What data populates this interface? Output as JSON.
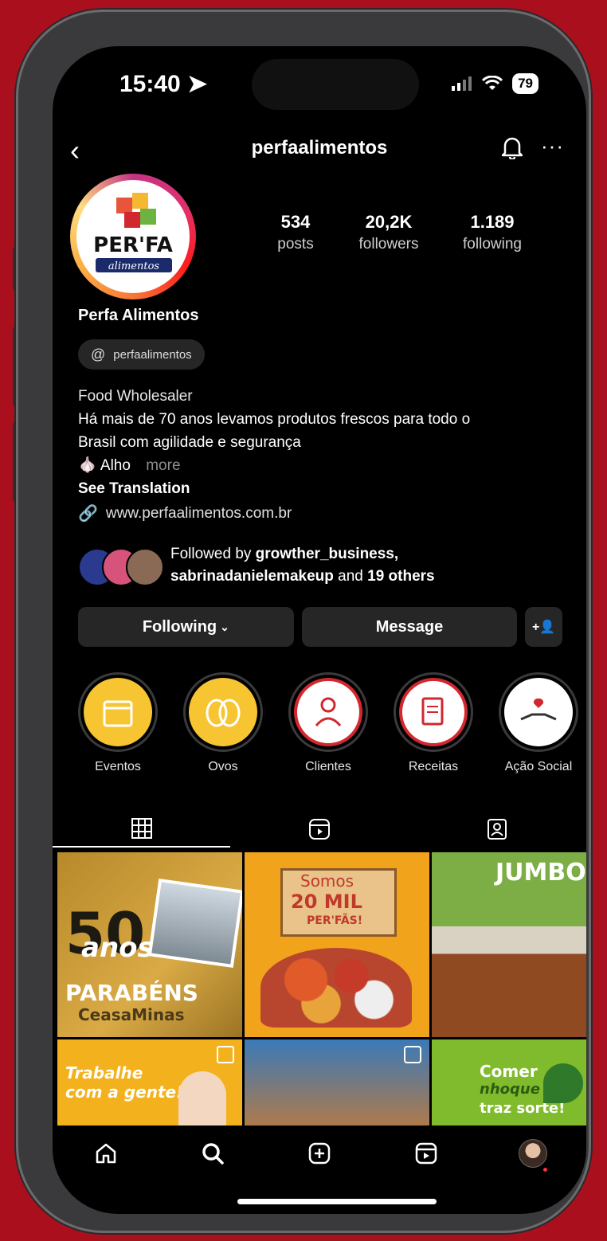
{
  "status_bar": {
    "time": "15:40",
    "battery": "79"
  },
  "header": {
    "username": "perfaalimentos"
  },
  "profile": {
    "avatar_brand": "PER'FA",
    "avatar_sub": "alimentos",
    "stats": [
      {
        "value": "534",
        "label": "posts"
      },
      {
        "value": "20,2K",
        "label": "followers"
      },
      {
        "value": "1.189",
        "label": "following"
      }
    ],
    "display_name": "Perfa Alimentos",
    "threads_handle": "perfaalimentos",
    "category": "Food Wholesaler",
    "bio_line1": "Há mais de 70 anos levamos produtos frescos para todo o",
    "bio_line2": "Brasil com agilidade e segurança",
    "bio_line3": "Alho",
    "bio_more": "more",
    "see_translation": "See Translation",
    "website": "www.perfaalimentos.com.br"
  },
  "followed_by": {
    "prefix": "Followed by",
    "user1": "growther_business,",
    "user2": "sabrinadanielemakeup",
    "and": "and",
    "others": "19 others"
  },
  "actions": {
    "following": "Following",
    "message": "Message"
  },
  "highlights": [
    {
      "label": "Eventos"
    },
    {
      "label": "Ovos"
    },
    {
      "label": "Clientes"
    },
    {
      "label": "Receitas"
    },
    {
      "label": "Ação Social"
    }
  ],
  "posts": {
    "p1_big": "50",
    "p1_script": "anos",
    "p1_caption": "PARABÉNS",
    "p1_sub": "CeasaMinas",
    "p2_line1": "Somos",
    "p2_line2": "20 MIL",
    "p2_line3": "PER'FÃS!",
    "p3_title": "JUMBO",
    "p4_line1": "Trabalhe",
    "p4_line2": "com a gente!",
    "p6_line1": "Comer",
    "p6_line2": "nhoque",
    "p6_line3": "traz sorte!"
  },
  "colors": {
    "background": "#a90f1c",
    "screen": "#000000",
    "button": "#262626"
  }
}
